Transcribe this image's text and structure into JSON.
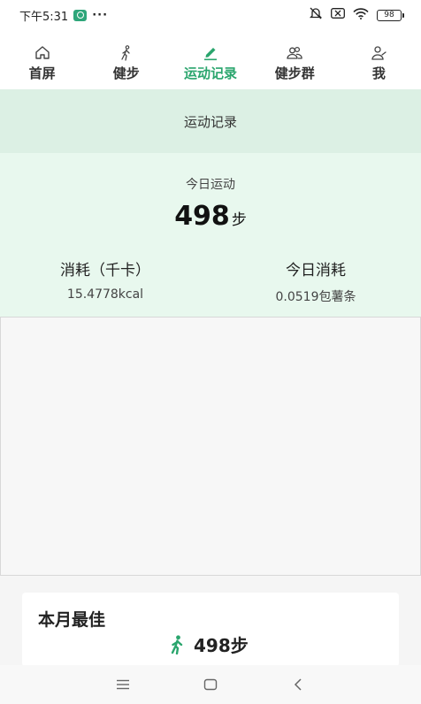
{
  "status_bar": {
    "time": "下午5:31",
    "overflow": "···",
    "battery": "98",
    "icons": [
      "app-shield-icon",
      "mute-bell-icon",
      "sim-off-icon",
      "wifi-icon",
      "battery-icon"
    ]
  },
  "tabs": [
    {
      "label": "首屏",
      "icon": "home-icon",
      "active": false
    },
    {
      "label": "健步",
      "icon": "walker-icon",
      "active": false
    },
    {
      "label": "运动记录",
      "icon": "pencil-icon",
      "active": true
    },
    {
      "label": "健步群",
      "icon": "group-icon",
      "active": false
    },
    {
      "label": "我",
      "icon": "profile-icon",
      "active": false
    }
  ],
  "header": {
    "title": "运动记录"
  },
  "today": {
    "label": "今日运动",
    "steps": "498",
    "steps_unit": "步",
    "consumption_title": "消耗（千卡）",
    "consumption_value": "15.4778kcal",
    "equivalent_title": "今日消耗",
    "equivalent_value": "0.0519包薯条"
  },
  "best": {
    "title": "本月最佳",
    "steps": "498步",
    "icon": "walker-icon"
  },
  "colors": {
    "accent": "#2aa56d",
    "header_bg": "#dcf0e4",
    "stats_bg": "#e8f8ee"
  },
  "nav": {
    "buttons": [
      "menu-icon",
      "home-square-icon",
      "back-icon"
    ]
  }
}
